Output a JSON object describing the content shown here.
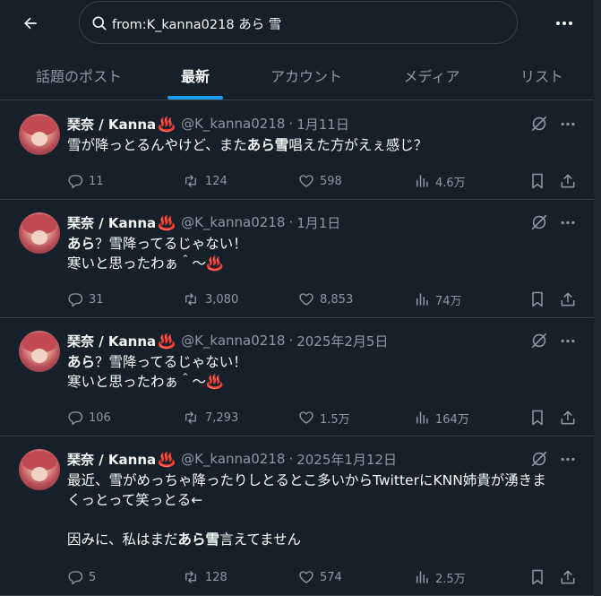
{
  "search": {
    "query": "from:K_kanna0218 あら 雪"
  },
  "tabs": [
    {
      "label": "話題のポスト",
      "active": false
    },
    {
      "label": "最新",
      "active": true
    },
    {
      "label": "アカウント",
      "active": false
    },
    {
      "label": "メディア",
      "active": false
    },
    {
      "label": "リスト",
      "active": false
    }
  ],
  "posts": [
    {
      "name": "琹奈 / Kanna",
      "name_emoji": "♨️",
      "handle": "@K_kanna0218",
      "date": "1月11日",
      "lines": [
        [
          {
            "t": "雪が降っとるんやけど、また"
          },
          {
            "t": "あら雪",
            "b": true
          },
          {
            "t": "唱えた方がえぇ感じ？"
          }
        ]
      ],
      "replies": "11",
      "reposts": "124",
      "likes": "598",
      "views": "4.6万"
    },
    {
      "name": "琹奈 / Kanna",
      "name_emoji": "♨️",
      "handle": "@K_kanna0218",
      "date": "1月1日",
      "lines": [
        [
          {
            "t": "あら",
            "b": true
          },
          {
            "t": "？雪降ってるじゃない！"
          }
        ],
        [
          {
            "t": "寒いと思ったわぁ＾〜♨️"
          }
        ]
      ],
      "replies": "31",
      "reposts": "3,080",
      "likes": "8,853",
      "views": "74万"
    },
    {
      "name": "琹奈 / Kanna",
      "name_emoji": "♨️",
      "handle": "@K_kanna0218",
      "date": "2025年2月5日",
      "lines": [
        [
          {
            "t": "あら",
            "b": true
          },
          {
            "t": "？雪降ってるじゃない！"
          }
        ],
        [
          {
            "t": "寒いと思ったわぁ＾〜♨️"
          }
        ]
      ],
      "replies": "106",
      "reposts": "7,293",
      "likes": "1.5万",
      "views": "164万"
    },
    {
      "name": "琹奈 / Kanna",
      "name_emoji": "♨️",
      "handle": "@K_kanna0218",
      "date": "2025年1月12日",
      "lines": [
        [
          {
            "t": "最近、雪がめっちゃ降ったりしとるとこ多いからTwitterにKNN姉貴が湧きま"
          }
        ],
        [
          {
            "t": "くっとって笑っとる←"
          }
        ],
        [
          {
            "t": " "
          }
        ],
        [
          {
            "t": "因みに、私はまだ"
          },
          {
            "t": "あら雪",
            "b": true
          },
          {
            "t": "言えてません"
          }
        ]
      ],
      "replies": "5",
      "reposts": "128",
      "likes": "574",
      "views": "2.5万"
    }
  ],
  "colors": {
    "background": "#15202b",
    "accent": "#1d9bf0",
    "muted": "#8b98a5",
    "border": "#38444d"
  }
}
